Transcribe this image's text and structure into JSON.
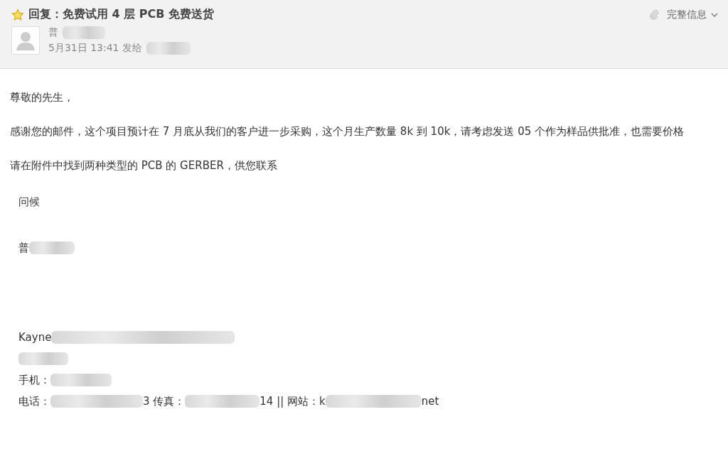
{
  "header": {
    "starred": true,
    "subject": "回复：免费试用 4 层 PCB 免费送货",
    "sender": [
      {
        "kind": "text",
        "text": "普"
      },
      {
        "kind": "blur"
      }
    ],
    "meta": [
      {
        "kind": "text",
        "text": "5月31日 13:41 发给"
      },
      {
        "kind": "blur"
      }
    ],
    "details_link": "完整信息"
  },
  "body": {
    "paragraphs": [
      "尊敬的先生，",
      "感谢您的邮件，这个项目预计在 7 月底从我们的客户进一步采购，这个月生产数量 8k 到 10k，请考虑发送 05 个作为样品供批准，也需要价格",
      "请在附件中找到两种类型的 PCB 的 GERBER，供您联系"
    ],
    "greeting": "问候",
    "name_line": [
      {
        "kind": "text",
        "text": "普"
      },
      {
        "kind": "blur"
      }
    ],
    "signature": [
      [
        {
          "kind": "text",
          "text": "Kayne"
        },
        {
          "kind": "blur"
        }
      ],
      [
        {
          "kind": "blur"
        }
      ],
      [
        {
          "kind": "text",
          "text": "手机："
        },
        {
          "kind": "blur"
        }
      ],
      [
        {
          "kind": "text",
          "text": "电话："
        },
        {
          "kind": "blur"
        },
        {
          "kind": "text",
          "text": "3 传真："
        },
        {
          "kind": "blur"
        },
        {
          "kind": "text",
          "text": "14 || 网站：k"
        },
        {
          "kind": "blur"
        },
        {
          "kind": "text",
          "text": "net"
        }
      ]
    ]
  }
}
